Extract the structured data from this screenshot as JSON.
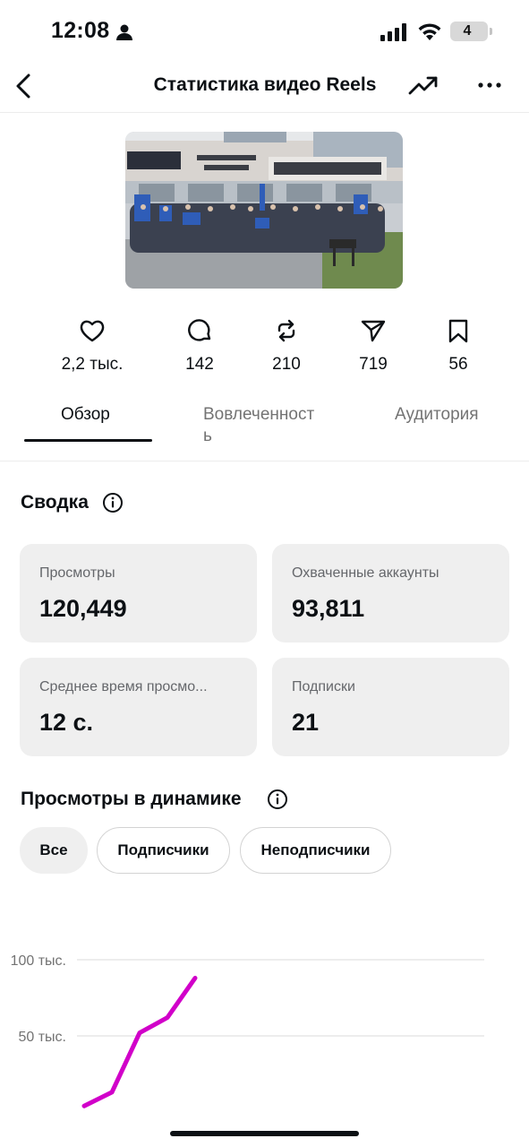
{
  "status_bar": {
    "time": "12:08",
    "battery_level": "4",
    "icons": [
      "person-icon",
      "cellular-signal-icon",
      "wifi-icon",
      "battery-icon"
    ]
  },
  "header": {
    "title": "Статистика видео Reels",
    "icons": [
      "back-arrow-icon",
      "trending-up-icon",
      "more-dots-icon"
    ]
  },
  "metrics": [
    {
      "icon": "heart-icon",
      "value": "2,2 тыс."
    },
    {
      "icon": "comment-icon",
      "value": "142"
    },
    {
      "icon": "repost-icon",
      "value": "210"
    },
    {
      "icon": "share-icon",
      "value": "719"
    },
    {
      "icon": "bookmark-icon",
      "value": "56"
    }
  ],
  "tabs": [
    {
      "label": "Обзор",
      "active": true
    },
    {
      "label": "Вовлеченност\nь",
      "active": false
    },
    {
      "label": "Аудитория",
      "active": false
    }
  ],
  "summary": {
    "title": "Сводка",
    "cards": [
      {
        "label": "Просмотры",
        "value": "120,449"
      },
      {
        "label": "Охваченные аккаунты",
        "value": "93,811"
      },
      {
        "label": "Среднее время просмо...",
        "value": "12 с."
      },
      {
        "label": "Подписки",
        "value": "21"
      }
    ]
  },
  "views_dynamics": {
    "title": "Просмотры в динамике",
    "filters": [
      {
        "label": "Все",
        "selected": true
      },
      {
        "label": "Подписчики",
        "selected": false
      },
      {
        "label": "Неподписчики",
        "selected": false
      }
    ]
  },
  "chart_data": {
    "type": "line",
    "y_tick_labels": [
      "100 тыс.",
      "50 тыс."
    ],
    "y_ticks": [
      100000,
      50000
    ],
    "series": [
      {
        "color": "#d100c9",
        "values": [
          4000,
          13000,
          52000,
          62000,
          88000
        ]
      }
    ],
    "grid": true
  },
  "colors": {
    "accent_line": "#d100c9",
    "card_background": "#efefef",
    "text_primary": "#0c1014",
    "text_secondary": "#737373"
  }
}
